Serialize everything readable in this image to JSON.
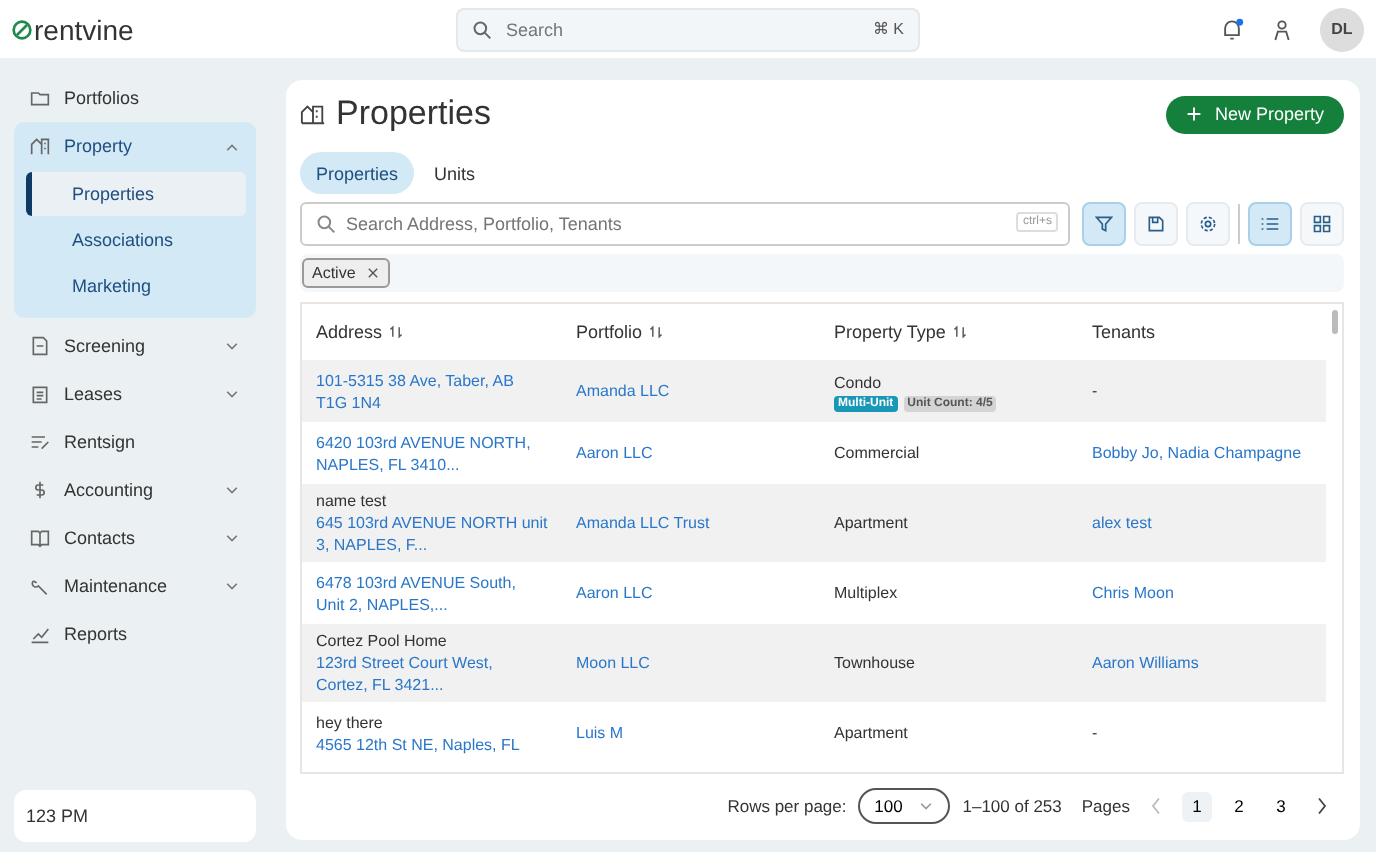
{
  "header": {
    "logo": "rentvine",
    "search": {
      "placeholder": "Search",
      "shortcut": "⌘ K"
    },
    "notifications": {
      "unread": true
    },
    "avatar": "DL"
  },
  "sidebar": {
    "items": [
      {
        "label": "Portfolios",
        "expanded": false,
        "expandable": false
      },
      {
        "label": "Property",
        "expanded": true,
        "expandable": true,
        "children": [
          {
            "label": "Properties",
            "selected": true
          },
          {
            "label": "Associations",
            "selected": false
          },
          {
            "label": "Marketing",
            "selected": false
          }
        ]
      },
      {
        "label": "Screening",
        "expanded": false,
        "expandable": true
      },
      {
        "label": "Leases",
        "expanded": false,
        "expandable": true
      },
      {
        "label": "Rentsign",
        "expanded": false,
        "expandable": false
      },
      {
        "label": "Accounting",
        "expanded": false,
        "expandable": true
      },
      {
        "label": "Contacts",
        "expanded": false,
        "expandable": true
      },
      {
        "label": "Maintenance",
        "expanded": false,
        "expandable": true
      },
      {
        "label": "Reports",
        "expanded": false,
        "expandable": false
      }
    ],
    "footer": "123 PM"
  },
  "page": {
    "title": "Properties",
    "new_button": "New Property",
    "tabs": [
      {
        "label": "Properties",
        "selected": true
      },
      {
        "label": "Units",
        "selected": false
      }
    ],
    "search": {
      "placeholder": "Search Address, Portfolio, Tenants",
      "shortcut": "ctrl+s"
    },
    "toolbar": {
      "filter_active": true,
      "views": [
        {
          "selected": true
        },
        {
          "selected": false
        }
      ]
    },
    "filters": [
      {
        "label": "Active"
      }
    ]
  },
  "table": {
    "columns": [
      {
        "label": "Address",
        "sortable": true
      },
      {
        "label": "Portfolio",
        "sortable": true
      },
      {
        "label": "Property Type",
        "sortable": true
      },
      {
        "label": "Tenants",
        "sortable": false
      }
    ],
    "rows": [
      {
        "name": "",
        "address": "101-5315 38 Ave, Taber, AB T1G 1N4",
        "portfolio": "Amanda LLC",
        "type": "Condo",
        "badges": [
          {
            "label": "Multi-Unit",
            "kind": "primary"
          },
          {
            "label": "Unit Count: 4/5",
            "kind": "muted"
          }
        ],
        "tenants": "-",
        "shaded": true
      },
      {
        "name": "",
        "address": "6420 103rd AVENUE NORTH, NAPLES, FL 3410...",
        "portfolio": "Aaron LLC",
        "type": "Commercial",
        "badges": [],
        "tenants": "Bobby Jo, Nadia Champagne",
        "shaded": false
      },
      {
        "name": "name test",
        "address": "645 103rd AVENUE NORTH unit 3, NAPLES, F...",
        "portfolio": "Amanda LLC Trust",
        "type": "Apartment",
        "badges": [],
        "tenants": "alex test",
        "shaded": true
      },
      {
        "name": "",
        "address": "6478 103rd AVENUE South, Unit 2, NAPLES,...",
        "portfolio": "Aaron LLC",
        "type": "Multiplex",
        "badges": [],
        "tenants": "Chris Moon",
        "shaded": false
      },
      {
        "name": "Cortez Pool Home",
        "address": "123rd Street Court West, Cortez, FL 3421...",
        "portfolio": "Moon LLC",
        "type": "Townhouse",
        "badges": [],
        "tenants": "Aaron Williams",
        "shaded": true
      },
      {
        "name": "hey there",
        "address": "4565 12th St NE, Naples, FL",
        "portfolio": "Luis M",
        "type": "Apartment",
        "badges": [],
        "tenants": "-",
        "shaded": false
      }
    ]
  },
  "pagination": {
    "rows_label": "Rows per page:",
    "rows_per_page": "100",
    "range": "1–100 of 253",
    "pages_label": "Pages",
    "pages": [
      {
        "label": "1",
        "selected": true
      },
      {
        "label": "2",
        "selected": false
      },
      {
        "label": "3",
        "selected": false
      }
    ]
  }
}
